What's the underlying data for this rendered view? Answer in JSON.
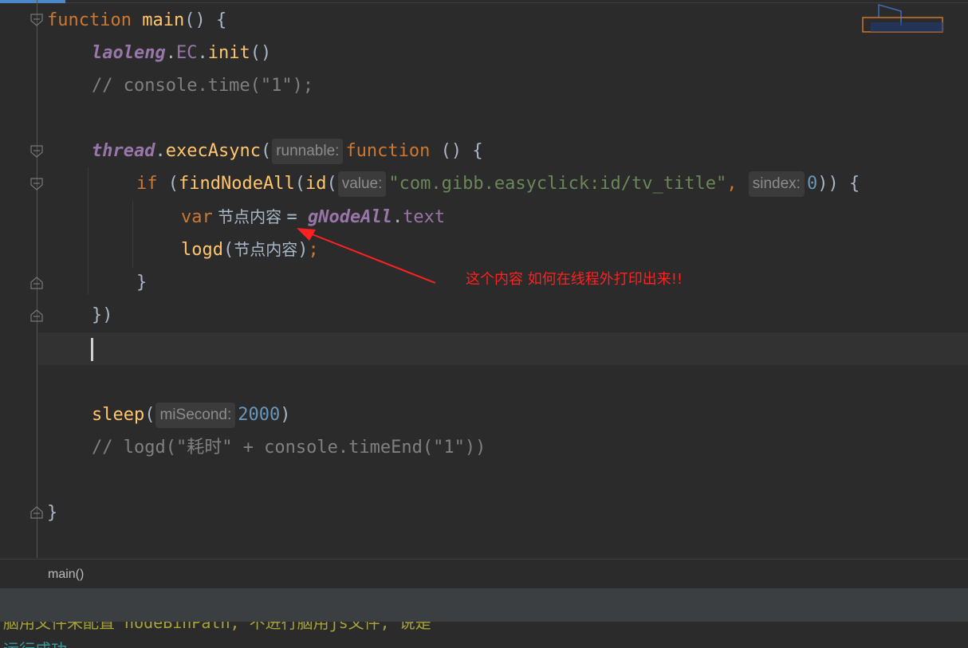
{
  "editor": {
    "lines": {
      "l1": {
        "kw": "function",
        "fn": "main",
        "rest": "() {"
      },
      "l2": {
        "obj": "laoleng",
        "dot1": ".",
        "prop": "EC",
        "dot2": ".",
        "fn": "init",
        "rest": "()"
      },
      "l3": {
        "comment": "// console.time(\"1\");"
      },
      "l5": {
        "obj": "thread",
        "dot": ".",
        "fn": "execAsync",
        "open": "(",
        "hint": "runnable:",
        "kw": "function",
        "rest": " () {"
      },
      "l6": {
        "kw": "if",
        "open": " (",
        "fn1": "findNodeAll",
        "p1": "(",
        "fn2": "id",
        "p2": "(",
        "hint1": "value:",
        "str": "\"com.gibb.easyclick:id/tv_title\"",
        "comma": ",",
        "hint2": "sindex:",
        "num": "0",
        "close": ")) {"
      },
      "l7": {
        "kw": "var",
        "var": " 节点内容 ",
        "eq": "= ",
        "glob": "gNodeAll",
        "dot": ".",
        "prop": "text"
      },
      "l8": {
        "fn": "logd",
        "open": "(",
        "var": "节点内容",
        "close": ")",
        "semi": ";"
      },
      "l9": {
        "text": "}"
      },
      "l10": {
        "text": "})"
      },
      "l13": {
        "fn": "sleep",
        "open": "(",
        "hint": "miSecond:",
        "num": "2000",
        "close": ")"
      },
      "l14": {
        "comment": "// logd(\"耗时\" + console.timeEnd(\"1\"))"
      },
      "l16": {
        "text": "}"
      }
    }
  },
  "annotation": {
    "text": "这个内容 如何在线程外打印出来!!",
    "color": "#ff2020"
  },
  "breadcrumb": {
    "label": "main()"
  },
  "console": {
    "line1": "脑用文件来配置 nodeBinPath, 不进行脑用js文件, 说是",
    "line2": "运行成功"
  },
  "icons": [
    "fold-icon",
    "annotation-arrow-icon",
    "watermark-logo-icon"
  ],
  "colors": {
    "keyword": "#cc7832",
    "function": "#ffc66d",
    "string": "#6a8759",
    "number": "#6897bb",
    "comment": "#808080",
    "global": "#9876aa"
  }
}
